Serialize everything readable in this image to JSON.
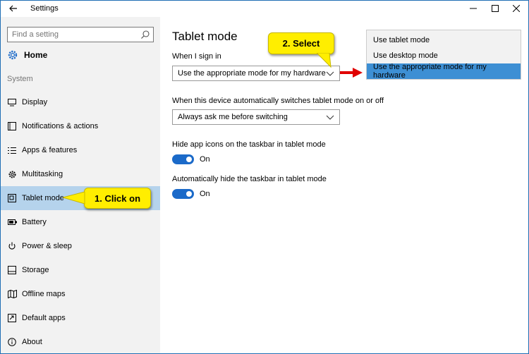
{
  "window": {
    "title": "Settings"
  },
  "sidebar": {
    "search_placeholder": "Find a setting",
    "home_label": "Home",
    "section_label": "System",
    "items": [
      {
        "label": "Display",
        "icon": "monitor-icon"
      },
      {
        "label": "Notifications & actions",
        "icon": "notifications-icon"
      },
      {
        "label": "Apps & features",
        "icon": "apps-list-icon"
      },
      {
        "label": "Multitasking",
        "icon": "multitasking-icon"
      },
      {
        "label": "Tablet mode",
        "icon": "tablet-mode-icon",
        "selected": true
      },
      {
        "label": "Battery",
        "icon": "battery-icon"
      },
      {
        "label": "Power & sleep",
        "icon": "power-icon"
      },
      {
        "label": "Storage",
        "icon": "storage-icon"
      },
      {
        "label": "Offline maps",
        "icon": "map-icon"
      },
      {
        "label": "Default apps",
        "icon": "default-apps-icon"
      },
      {
        "label": "About",
        "icon": "info-icon"
      }
    ]
  },
  "main": {
    "title": "Tablet mode",
    "sign_in_label": "When I sign in",
    "sign_in_value": "Use the appropriate mode for my hardware",
    "switch_label": "When this device automatically switches tablet mode on or off",
    "switch_value": "Always ask me before switching",
    "hide_icons_label": "Hide app icons on the taskbar in tablet mode",
    "hide_icons_state": "On",
    "hide_taskbar_label": "Automatically hide the taskbar in tablet mode",
    "hide_taskbar_state": "On"
  },
  "popup": {
    "options": [
      "Use tablet mode",
      "Use desktop mode",
      "Use the appropriate mode for my hardware"
    ],
    "selected_index": 2
  },
  "annotations": {
    "step1": "1. Click on",
    "step2": "2. Select"
  },
  "colors": {
    "accent": "#1b6ac9",
    "selection_sidebar": "#b5d3ec",
    "selection_popup": "#3d8fd4",
    "callout": "#ffee00",
    "arrow": "#e00000"
  }
}
